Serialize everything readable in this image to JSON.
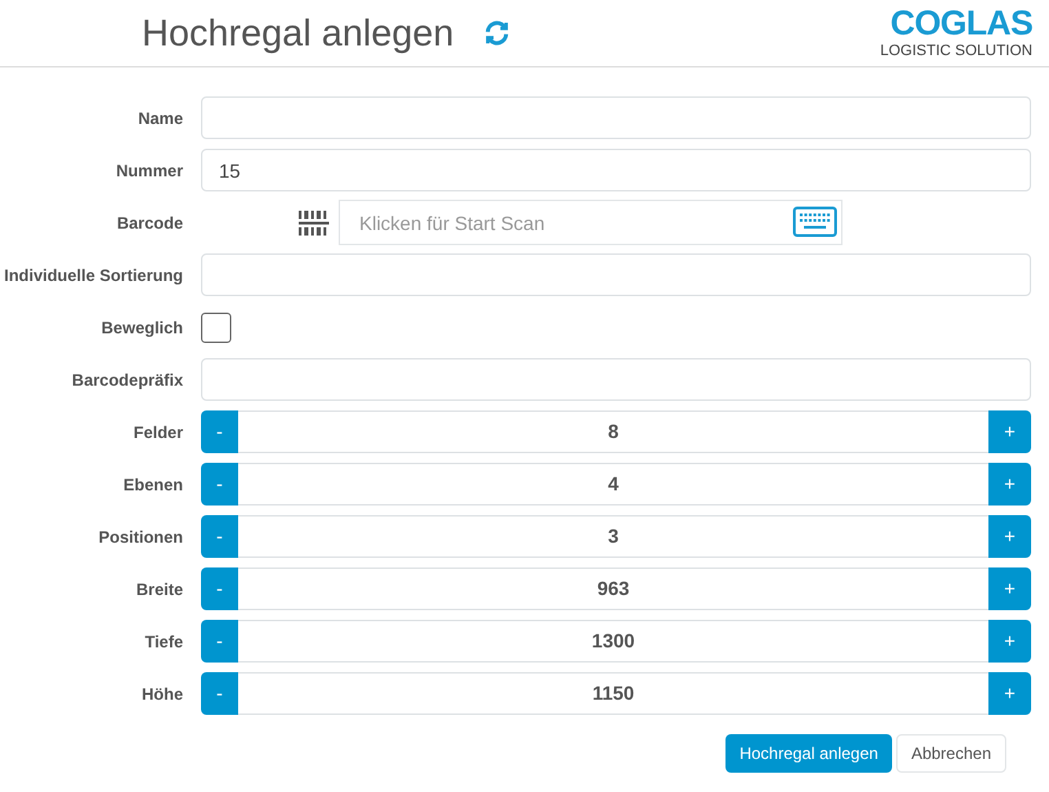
{
  "header": {
    "title": "Hochregal anlegen",
    "logo": {
      "name": "COGLAS",
      "tagline": "LOGISTIC SOLUTION"
    }
  },
  "fields": [
    {
      "kind": "text",
      "label": "Name"
    },
    {
      "kind": "text",
      "label": "Nummer",
      "value": "15"
    },
    {
      "kind": "barcode",
      "label": "Barcode",
      "placeholder": "Klicken für Start Scan"
    },
    {
      "kind": "text",
      "label": "Individuelle Sortierung"
    },
    {
      "kind": "checkbox",
      "label": "Beweglich",
      "checked": false
    },
    {
      "kind": "text",
      "label": "Barcodepräfix"
    },
    {
      "kind": "stepper",
      "label": "Felder",
      "value": "8",
      "minus": "-",
      "plus": "+"
    },
    {
      "kind": "stepper",
      "label": "Ebenen",
      "value": "4",
      "minus": "-",
      "plus": "+"
    },
    {
      "kind": "stepper",
      "label": "Positionen",
      "value": "3",
      "minus": "-",
      "plus": "+"
    },
    {
      "kind": "stepper",
      "label": "Breite",
      "value": "963",
      "minus": "-",
      "plus": "+"
    },
    {
      "kind": "stepper",
      "label": "Tiefe",
      "value": "1300",
      "minus": "-",
      "plus": "+"
    },
    {
      "kind": "stepper",
      "label": "Höhe",
      "value": "1150",
      "minus": "-",
      "plus": "+"
    }
  ],
  "buttons": [
    {
      "kind": "primary",
      "label": "Hochregal anlegen"
    },
    {
      "kind": "secondary",
      "label": "Abbrechen"
    }
  ]
}
